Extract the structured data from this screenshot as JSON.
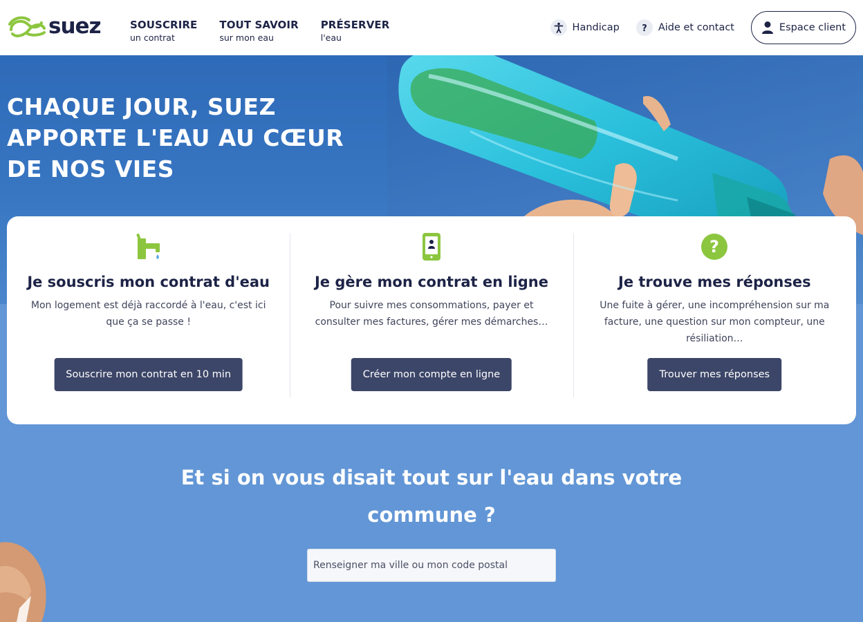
{
  "header": {
    "logo_text": "suez",
    "nav": [
      {
        "title": "SOUSCRIRE",
        "sub": "un contrat"
      },
      {
        "title": "TOUT SAVOIR",
        "sub": "sur mon eau"
      },
      {
        "title": "PRÉSERVER",
        "sub": "l'eau"
      }
    ],
    "handicap_label": "Handicap",
    "help_label": "Aide et contact",
    "client_label": "Espace client"
  },
  "hero": {
    "title_lines": [
      "CHAQUE JOUR, SUEZ",
      "APPORTE L'EAU AU CŒUR",
      "DE NOS VIES"
    ]
  },
  "cards": [
    {
      "icon": "faucet-icon",
      "title": "Je souscris mon contrat d'eau",
      "text": "Mon logement est déjà raccordé à l'eau, c'est ici que ça se passe !",
      "button": "Souscrire mon contrat en 10 min"
    },
    {
      "icon": "smartphone-icon",
      "title": "Je gère mon contrat en ligne",
      "text": "Pour suivre mes consommations, payer et consulter mes factures, gérer mes démarches…",
      "button": "Créer mon compte en ligne"
    },
    {
      "icon": "question-icon",
      "title": "Je trouve mes réponses",
      "text": "Une fuite à gérer, une incompréhension sur ma facture, une question sur mon compteur, une résiliation…",
      "button": "Trouver mes réponses"
    }
  ],
  "commune": {
    "title": "Et si on vous disait tout sur l'eau dans votre commune ?",
    "placeholder": "Renseigner ma ville ou mon code postal"
  },
  "colors": {
    "navy": "#1d2346",
    "button": "#3c4668",
    "accent_green": "#8cc63f",
    "hero_blue": "#3876c2",
    "section_blue": "#6296d6"
  }
}
